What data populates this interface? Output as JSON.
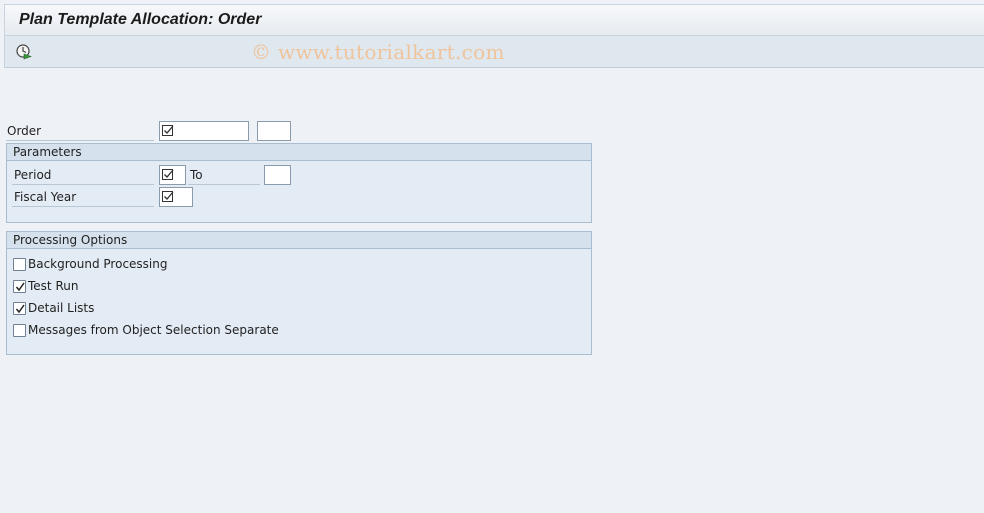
{
  "window": {
    "title": "Plan Template Allocation: Order"
  },
  "toolbar": {
    "execute_icon": "execute-clock-icon"
  },
  "watermark": "© www.tutorialkart.com",
  "order": {
    "label": "Order",
    "value": "",
    "to_value": ""
  },
  "parameters": {
    "header": "Parameters",
    "period_label": "Period",
    "period_value": "",
    "to_label": "To",
    "period_to_value": "",
    "fiscal_year_label": "Fiscal Year",
    "fiscal_year_value": ""
  },
  "processing": {
    "header": "Processing Options",
    "options": [
      {
        "label": "Background Processing",
        "checked": false
      },
      {
        "label": "Test Run",
        "checked": true
      },
      {
        "label": "Detail Lists",
        "checked": true
      },
      {
        "label": "Messages from Object Selection Separate",
        "checked": false
      }
    ]
  }
}
